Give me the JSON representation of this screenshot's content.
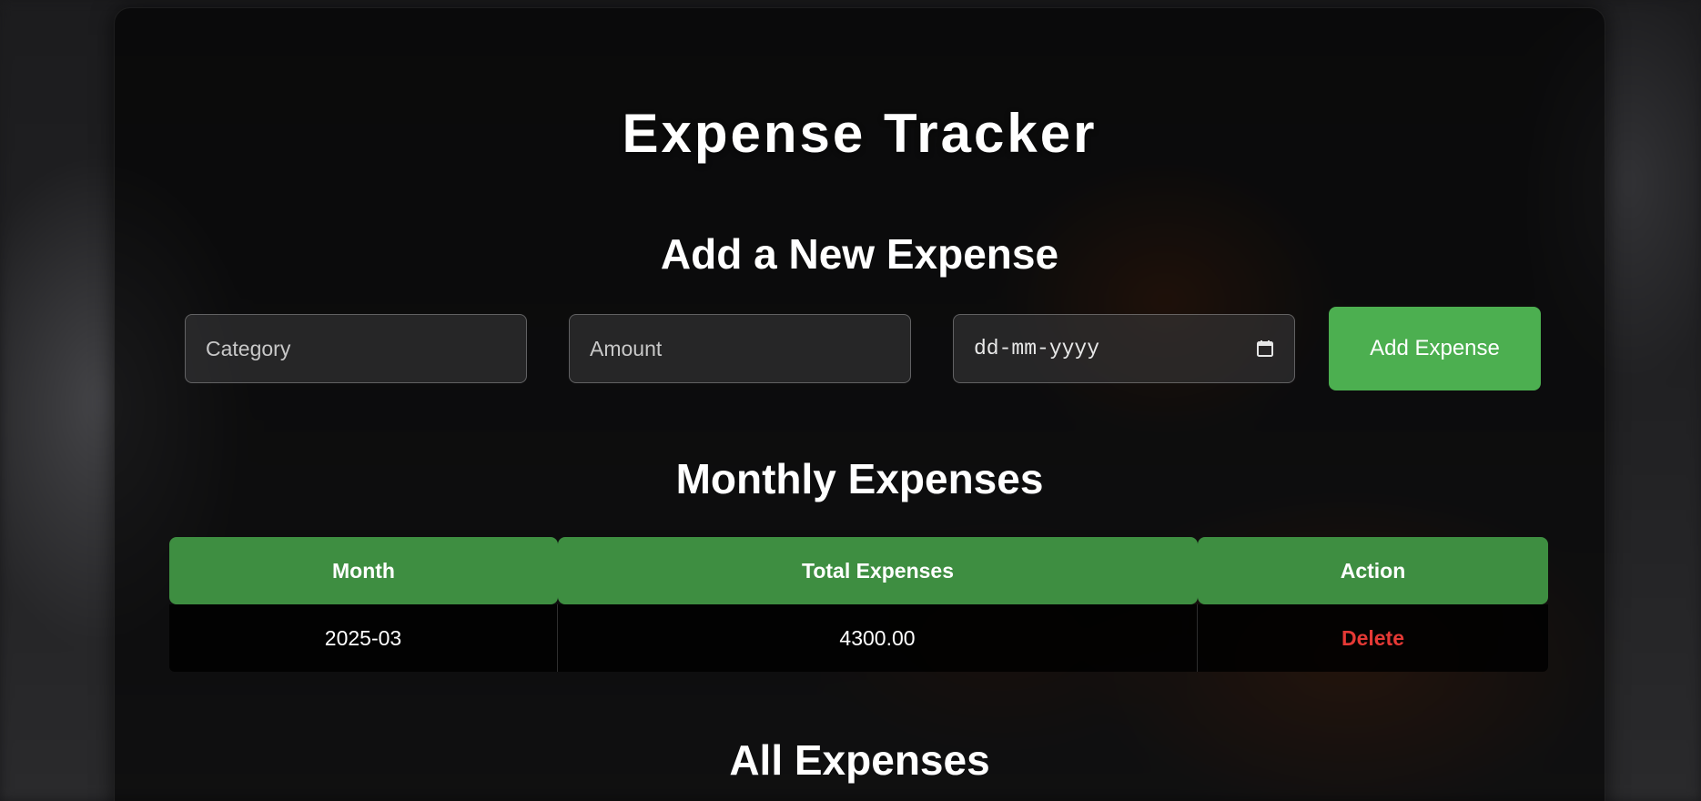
{
  "app": {
    "title": "Expense Tracker"
  },
  "add_form": {
    "heading": "Add a New Expense",
    "category_placeholder": "Category",
    "amount_placeholder": "Amount",
    "date_placeholder": "dd-mm-yyyy",
    "date_icon": "calendar-icon",
    "submit_label": "Add Expense"
  },
  "monthly": {
    "heading": "Monthly Expenses",
    "columns": [
      "Month",
      "Total Expenses",
      "Action"
    ],
    "rows": [
      {
        "month": "2025-03",
        "total": "4300.00",
        "action": "Delete"
      }
    ]
  },
  "all_expenses": {
    "heading": "All Expenses"
  },
  "colors": {
    "accent": "#4caf50",
    "header": "#3e8e41",
    "danger": "#e53935"
  }
}
